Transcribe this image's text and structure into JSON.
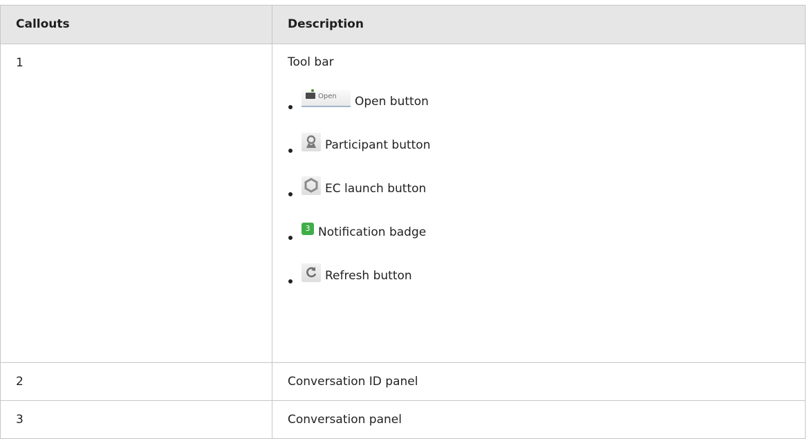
{
  "table": {
    "headers": [
      "Callouts",
      "Description"
    ],
    "rows": [
      {
        "callout": "1",
        "description": "Tool bar",
        "items": [
          {
            "icon": "open-folder-icon",
            "icon_text": "Open",
            "label": "Open button"
          },
          {
            "icon": "participant-icon",
            "label": "Participant button"
          },
          {
            "icon": "ec-launch-icon",
            "label": "EC launch button"
          },
          {
            "icon": "notification-badge-icon",
            "icon_text": "3",
            "label": "Notification badge"
          },
          {
            "icon": "refresh-icon",
            "label": "Refresh button"
          }
        ]
      },
      {
        "callout": "2",
        "description": "Conversation ID panel"
      },
      {
        "callout": "3",
        "description": "Conversation panel"
      }
    ]
  },
  "colors": {
    "header_bg": "#e6e6e6",
    "border": "#c6c6c6",
    "badge_green": "#3fae49"
  }
}
